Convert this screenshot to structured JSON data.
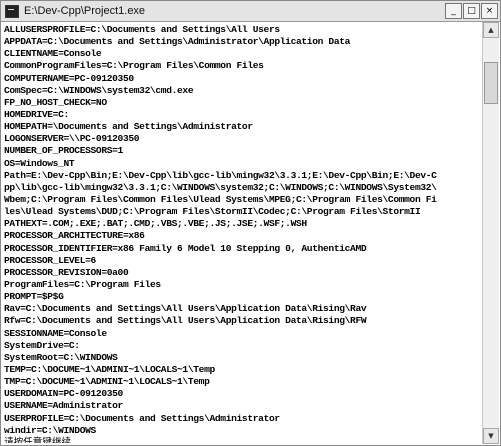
{
  "window": {
    "title": "E:\\Dev-Cpp\\Project1.exe",
    "controls": {
      "minimize": "_",
      "maximize": "□",
      "close": "×"
    }
  },
  "console": {
    "lines": [
      "ALLUSERSPROFILE=C:\\Documents and Settings\\All Users",
      "APPDATA=C:\\Documents and Settings\\Administrator\\Application Data",
      "CLIENTNAME=Console",
      "CommonProgramFiles=C:\\Program Files\\Common Files",
      "COMPUTERNAME=PC-09120350",
      "ComSpec=C:\\WINDOWS\\system32\\cmd.exe",
      "FP_NO_HOST_CHECK=NO",
      "HOMEDRIVE=C:",
      "HOMEPATH=\\Documents and Settings\\Administrator",
      "LOGONSERVER=\\\\PC-09120350",
      "NUMBER_OF_PROCESSORS=1",
      "OS=Windows_NT",
      "Path=E:\\Dev-Cpp\\Bin;E:\\Dev-Cpp\\lib\\gcc-lib\\mingw32\\3.3.1;E:\\Dev-Cpp\\Bin;E:\\Dev-C",
      "pp\\lib\\gcc-lib\\mingw32\\3.3.1;C:\\WINDOWS\\system32;C:\\WINDOWS;C:\\WINDOWS\\System32\\",
      "Wbem;C:\\Program Files\\Common Files\\Ulead Systems\\MPEG;C:\\Program Files\\Common Fi",
      "les\\Ulead Systems\\DUD;C:\\Program Files\\StormII\\Codec;C:\\Program Files\\StormII",
      "PATHEXT=.COM;.EXE;.BAT;.CMD;.VBS;.VBE;.JS;.JSE;.WSF;.WSH",
      "PROCESSOR_ARCHITECTURE=x86",
      "PROCESSOR_IDENTIFIER=x86 Family 6 Model 10 Stepping 0, AuthenticAMD",
      "PROCESSOR_LEVEL=6",
      "PROCESSOR_REVISION=0a00",
      "ProgramFiles=C:\\Program Files",
      "PROMPT=$P$G",
      "Rav=C:\\Documents and Settings\\All Users\\Application Data\\Rising\\Rav",
      "Rfw=C:\\Documents and Settings\\All Users\\Application Data\\Rising\\RFW",
      "SESSIONNAME=Console",
      "SystemDrive=C:",
      "SystemRoot=C:\\WINDOWS",
      "TEMP=C:\\DOCUME~1\\ADMINI~1\\LOCALS~1\\Temp",
      "TMP=C:\\DOCUME~1\\ADMINI~1\\LOCALS~1\\Temp",
      "USERDOMAIN=PC-09120350",
      "USERNAME=Administrator",
      "USERPROFILE=C:\\Documents and Settings\\Administrator",
      "windir=C:\\WINDOWS"
    ],
    "prompt_line": "请按任意键继续. . ."
  }
}
